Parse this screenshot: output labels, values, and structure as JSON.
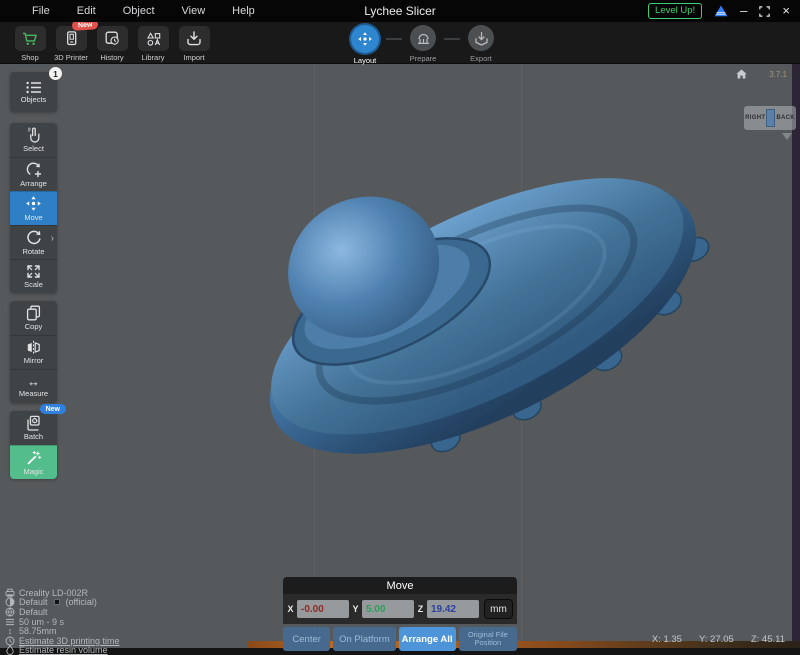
{
  "titlebar": {
    "menus": [
      "File",
      "Edit",
      "Object",
      "View",
      "Help"
    ],
    "title": "Lychee Slicer",
    "level_up_label": "Level Up!",
    "version": "3.7.1"
  },
  "watermark": {
    "left": "RIGHT",
    "right": "BACK"
  },
  "toolbar": {
    "items": [
      {
        "label": "Shop"
      },
      {
        "label": "3D Printer",
        "badge": "New"
      },
      {
        "label": "History"
      },
      {
        "label": "Library"
      },
      {
        "label": "Import"
      }
    ],
    "steps": [
      {
        "label": "Layout",
        "active": true
      },
      {
        "label": "Prepare",
        "active": false
      },
      {
        "label": "Export",
        "active": false
      }
    ]
  },
  "sidebar": {
    "objects": {
      "label": "Objects",
      "badge": "1"
    },
    "tools": [
      {
        "label": "Select"
      },
      {
        "label": "Arrange"
      },
      {
        "label": "Move",
        "active": true
      },
      {
        "label": "Rotate"
      },
      {
        "label": "Scale"
      }
    ],
    "edit_tools": [
      {
        "label": "Copy"
      },
      {
        "label": "Mirror"
      },
      {
        "label": "Measure"
      }
    ],
    "extra_tools": [
      {
        "label": "Batch",
        "badge": "New"
      },
      {
        "label": "Magic",
        "active": true
      }
    ]
  },
  "status": {
    "printer": "Creality LD-002R",
    "resin": "Default",
    "resin_suffix": "(official)",
    "profile": "Default",
    "layer_info": "50 um - 9 s",
    "build_height": "58.75mm",
    "estimate_time_link": "Estimate 3D printing time",
    "estimate_volume_link": "Estimate resin volume"
  },
  "move_panel": {
    "title": "Move",
    "fields": [
      {
        "label": "X",
        "value": "-0.00"
      },
      {
        "label": "Y",
        "value": "5.00"
      },
      {
        "label": "Z",
        "value": "19.42"
      }
    ],
    "unit": "mm",
    "buttons": [
      "Center",
      "On Platform",
      "Arrange All",
      "Original File Position"
    ]
  },
  "coords": {
    "x": "X: 1.35",
    "y": "Y: 27.05",
    "z": "Z: 45.11"
  },
  "colors": {
    "viewport_bg": "#56595b",
    "model_blue": "#40739f",
    "accent_blue": "#2e86cf",
    "accent_green": "#53bd8c",
    "shop_green": "#46b85f",
    "badge_red": "#e0514a",
    "badge_blue": "#2f80e0",
    "level_up_green": "#3fcf6f",
    "x_value_color": "#8e2a22",
    "y_value_color": "#2f9e57",
    "z_value_color": "#2b3f9e",
    "orange_band": "#c26d22"
  }
}
